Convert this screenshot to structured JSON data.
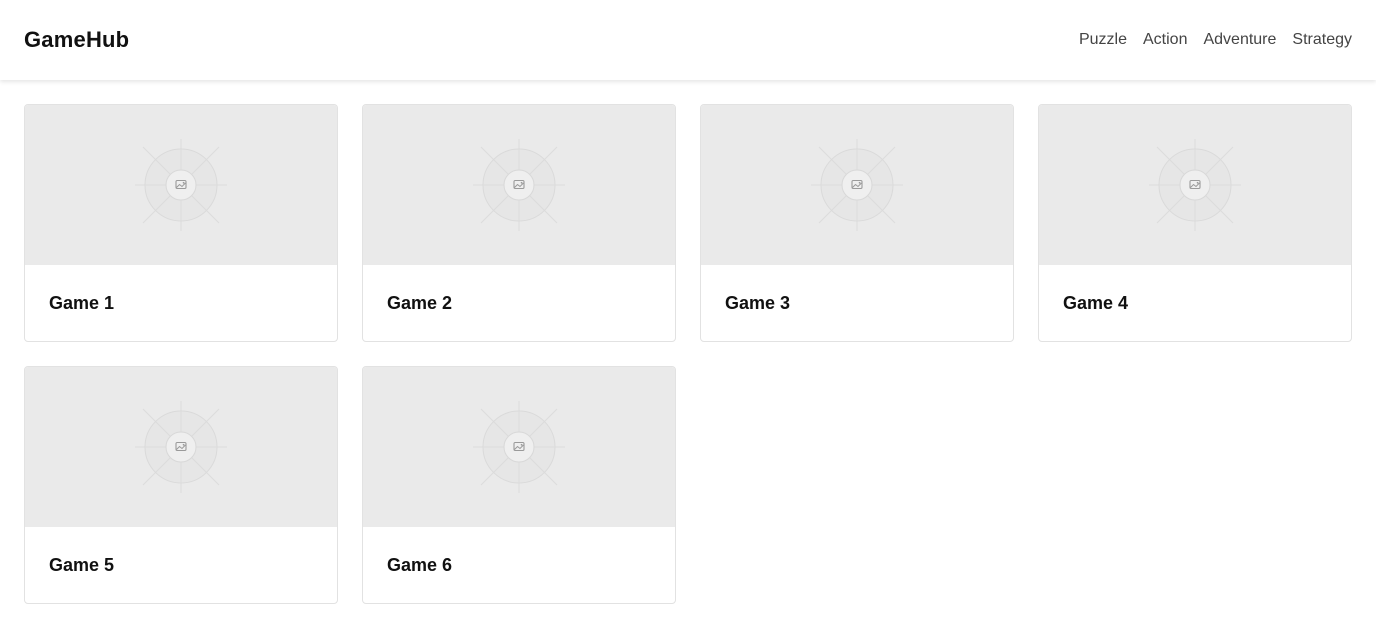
{
  "header": {
    "brand": "GameHub",
    "nav": [
      {
        "label": "Puzzle"
      },
      {
        "label": "Action"
      },
      {
        "label": "Adventure"
      },
      {
        "label": "Strategy"
      }
    ]
  },
  "games": [
    {
      "title": "Game 1",
      "image_icon": "image-placeholder-icon"
    },
    {
      "title": "Game 2",
      "image_icon": "image-placeholder-icon"
    },
    {
      "title": "Game 3",
      "image_icon": "image-placeholder-icon"
    },
    {
      "title": "Game 4",
      "image_icon": "image-placeholder-icon"
    },
    {
      "title": "Game 5",
      "image_icon": "image-placeholder-icon"
    },
    {
      "title": "Game 6",
      "image_icon": "image-placeholder-icon"
    }
  ],
  "colors": {
    "thumbnail_bg": "#eaeaea",
    "card_border": "#e2e2e2",
    "nav_text": "#444444",
    "title_text": "#111111"
  }
}
